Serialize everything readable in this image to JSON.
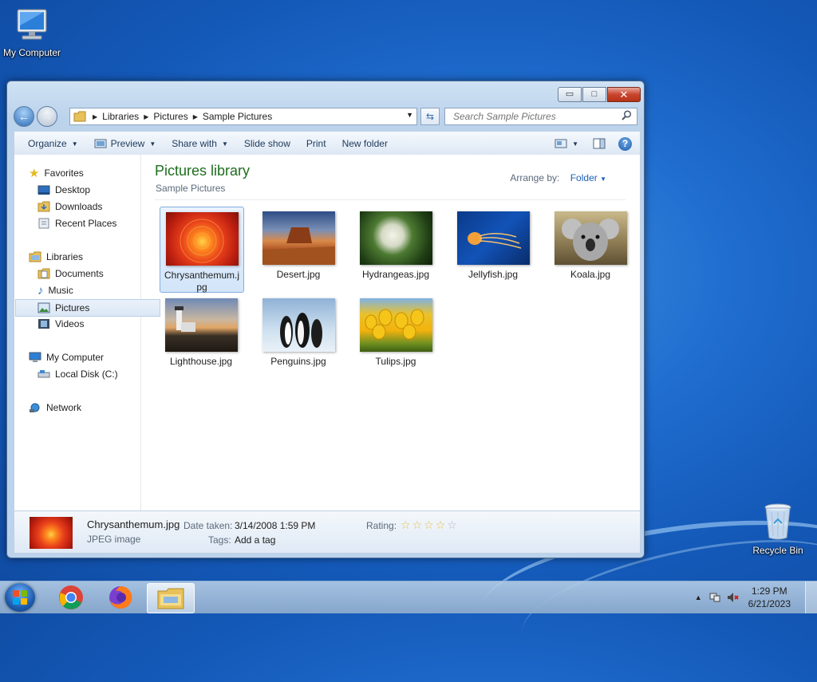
{
  "desktop": {
    "icons": [
      {
        "label": "My Computer"
      },
      {
        "label": "Recycle Bin"
      }
    ]
  },
  "window": {
    "buttons": {
      "minimize": "▭",
      "maximize": "□",
      "close": "✕"
    },
    "breadcrumb": [
      "Libraries",
      "Pictures",
      "Sample Pictures"
    ],
    "search_placeholder": "Search Sample Pictures",
    "toolbar": {
      "organize": "Organize",
      "preview": "Preview",
      "share_with": "Share with",
      "slide_show": "Slide show",
      "print": "Print",
      "new_folder": "New folder"
    },
    "nav": {
      "favorites": "Favorites",
      "desktop": "Desktop",
      "downloads": "Downloads",
      "recent_places": "Recent Places",
      "libraries": "Libraries",
      "documents": "Documents",
      "music": "Music",
      "pictures": "Pictures",
      "videos": "Videos",
      "my_computer": "My Computer",
      "local_disk": "Local Disk (C:)",
      "network": "Network"
    },
    "library": {
      "title": "Pictures library",
      "subtitle": "Sample Pictures",
      "arrange_label": "Arrange by:",
      "arrange_value": "Folder"
    },
    "files": [
      {
        "name": "Chrysanthemum.jpg"
      },
      {
        "name": "Desert.jpg"
      },
      {
        "name": "Hydrangeas.jpg"
      },
      {
        "name": "Jellyfish.jpg"
      },
      {
        "name": "Koala.jpg"
      },
      {
        "name": "Lighthouse.jpg"
      },
      {
        "name": "Penguins.jpg"
      },
      {
        "name": "Tulips.jpg"
      }
    ],
    "details": {
      "name": "Chrysanthemum.jpg",
      "type": "JPEG image",
      "date_taken_label": "Date taken:",
      "date_taken": "3/14/2008 1:59 PM",
      "tags_label": "Tags:",
      "tags_value": "Add a tag",
      "rating_label": "Rating:"
    }
  },
  "taskbar": {
    "time": "1:29 PM",
    "date": "6/21/2023"
  }
}
